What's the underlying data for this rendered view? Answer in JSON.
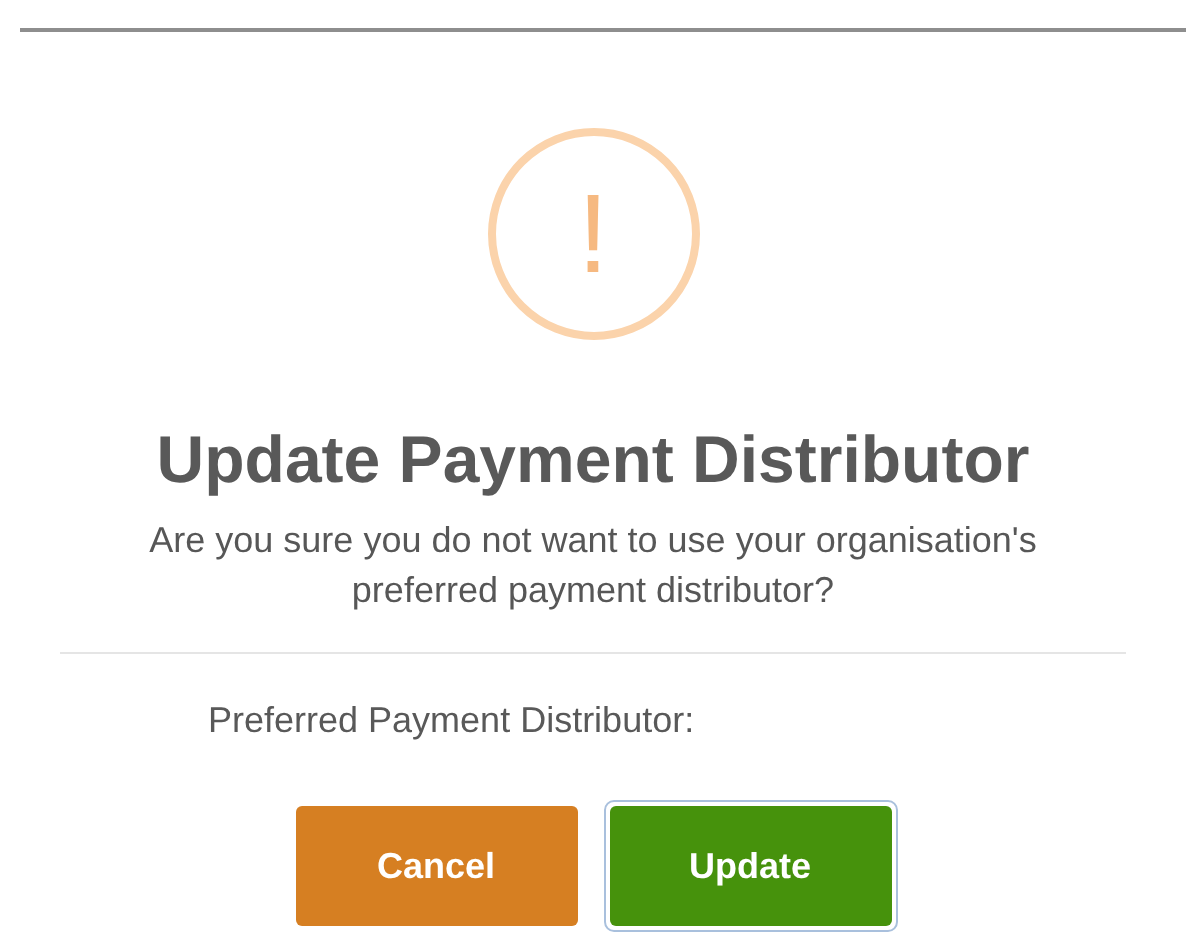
{
  "dialog": {
    "icon": "!",
    "title": "Update Payment Distributor",
    "message_lines": [
      "Are you sure you do not want to use your organisation's",
      "preferred payment distributor?"
    ],
    "field_label": "Preferred Payment Distributor:",
    "buttons": [
      {
        "label": "Cancel",
        "kind": "cancel",
        "focused": false
      },
      {
        "label": "Update",
        "kind": "confirm",
        "focused": true
      }
    ]
  }
}
